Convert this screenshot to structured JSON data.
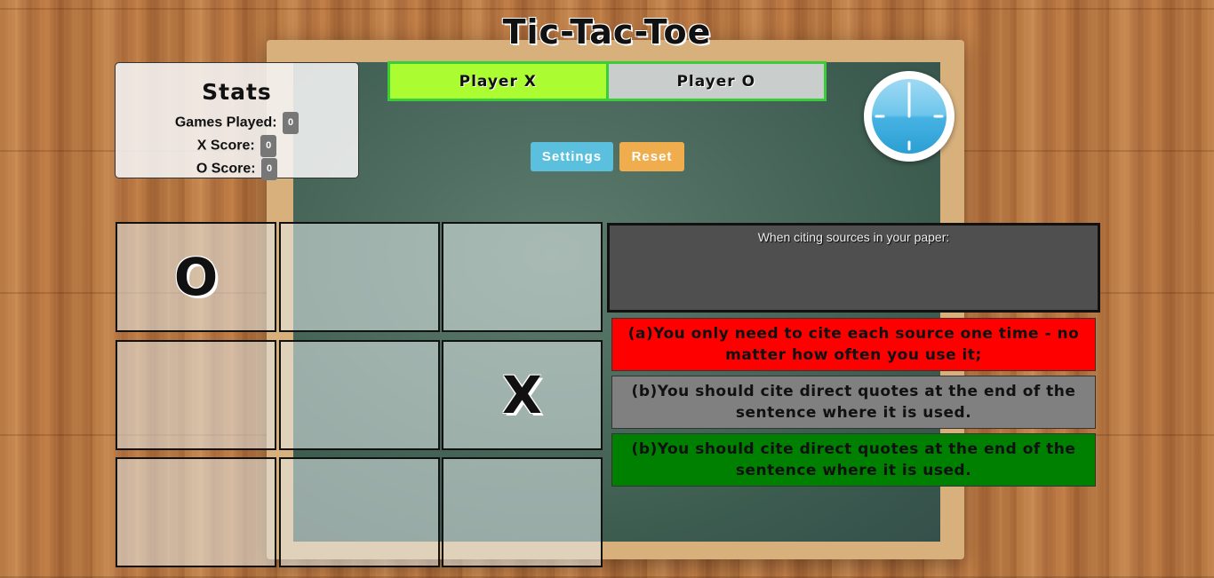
{
  "title": "Tic-Tac-Toe",
  "stats": {
    "heading": "Stats",
    "games_played_label": "Games Played:",
    "games_played": "0",
    "x_score_label": "X Score:",
    "x_score": "0",
    "o_score_label": "O Score:",
    "o_score": "0"
  },
  "players": {
    "x_label": "Player X",
    "o_label": "Player O",
    "active": "X"
  },
  "buttons": {
    "settings": "Settings",
    "reset": "Reset"
  },
  "board": {
    "cells": [
      "O",
      "",
      "",
      "",
      "",
      "X",
      "",
      "",
      ""
    ]
  },
  "question": {
    "text": "When citing sources in your paper:"
  },
  "answers": [
    {
      "text": "(a)You only need to cite each source one time - no matter how often you use it;",
      "color": "#ff0000"
    },
    {
      "text": "(b)You should cite direct quotes at the end of the sentence where it is used.",
      "color": "#808080"
    },
    {
      "text": "(b)You should cite direct quotes at the end of the sentence where it is used.",
      "color": "#008000"
    }
  ],
  "colors": {
    "active_player": "#acfc32",
    "inactive_player": "#c9cdcc",
    "settings_button": "#5bc0de",
    "reset_button": "#f0ad4e"
  },
  "icons": {
    "timer": "stopwatch-icon"
  }
}
